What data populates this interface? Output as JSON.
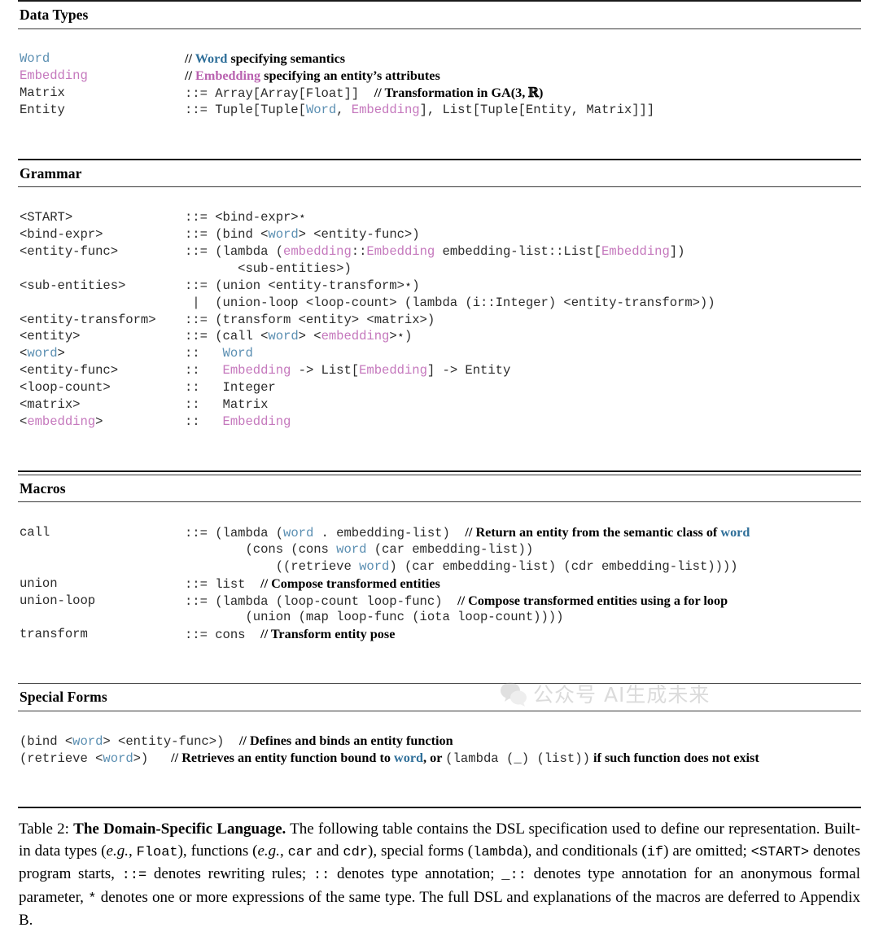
{
  "table": {
    "sections": [
      {
        "heading": "Data Types",
        "rows": [
          {
            "lhs": "Word",
            "lhs_color": "blue",
            "rhs": "// Word specifying semantics",
            "rhs_kind": "comment"
          },
          {
            "lhs": "Embedding",
            "lhs_color": "pink",
            "rhs": "// Embedding specifying an entity's attributes",
            "rhs_kind": "comment"
          },
          {
            "lhs": "Matrix",
            "lhs_color": "plain",
            "rhs": "::= Array[Array[Float]]  // Transformation in GA(3, R)"
          },
          {
            "lhs": "Entity",
            "lhs_color": "plain",
            "rhs": "::= Tuple[Tuple[Word, Embedding], List[Tuple[Entity, Matrix]]]"
          }
        ]
      },
      {
        "heading": "Grammar",
        "rows": [
          {
            "lhs": "<START>",
            "rhs": "::= <bind-expr>*"
          },
          {
            "lhs": "<bind-expr>",
            "rhs": "::= (bind <word> <entity-func>)"
          },
          {
            "lhs": "<entity-func>",
            "rhs": "::= (lambda (embedding::Embedding embedding-list::List[Embedding])"
          },
          {
            "lhs": "",
            "rhs": "       <sub-entities>)"
          },
          {
            "lhs": "<sub-entities>",
            "rhs": "::= (union <entity-transform>*)"
          },
          {
            "lhs": "",
            "rhs": " |  (union-loop <loop-count> (lambda (i::Integer) <entity-transform>))"
          },
          {
            "lhs": "<entity-transform>",
            "rhs": "::= (transform <entity> <matrix>)"
          },
          {
            "lhs": "<entity>",
            "rhs": "::= (call <word> <embedding>*)"
          },
          {
            "lhs": "<word>",
            "rhs": "::   Word"
          },
          {
            "lhs": "<entity-func>",
            "rhs": "::   Embedding -> List[Embedding] -> Entity"
          },
          {
            "lhs": "<loop-count>",
            "rhs": "::   Integer"
          },
          {
            "lhs": "<matrix>",
            "rhs": "::   Matrix"
          },
          {
            "lhs": "<embedding>",
            "rhs": "::   Embedding"
          }
        ]
      },
      {
        "heading": "Macros",
        "rows": [
          {
            "lhs": "call",
            "rhs": "::= (lambda (word . embedding-list)  // Return an entity from the semantic class of word"
          },
          {
            "lhs": "",
            "rhs": "        (cons (cons word (car embedding-list))"
          },
          {
            "lhs": "",
            "rhs": "            ((retrieve word) (car embedding-list) (cdr embedding-list))))"
          },
          {
            "lhs": "union",
            "rhs": "::= list  // Compose transformed entities"
          },
          {
            "lhs": "union-loop",
            "rhs": "::= (lambda (loop-count loop-func)  // Compose transformed entities using a for loop"
          },
          {
            "lhs": "",
            "rhs": "        (union (map loop-func (iota loop-count))))"
          },
          {
            "lhs": "transform",
            "rhs": "::= cons  // Transform entity pose"
          }
        ]
      },
      {
        "heading": "Special Forms",
        "rows": [
          {
            "rhs": "(bind <word> <entity-func>)  // Defines and binds an entity function"
          },
          {
            "rhs": "(retrieve <word>)   // Retrieves an entity function bound to word, or (lambda (_) (list)) if such function does not exist"
          }
        ]
      }
    ]
  },
  "caption": {
    "label": "Table 2:",
    "title": "The Domain-Specific Language.",
    "body_1": " The following table contains the DSL specification used to define our representation. Built-in data types (",
    "eg_1": "e.g.",
    "body_2": ", ",
    "mono_1": "Float",
    "body_3": "), functions (",
    "eg_2": "e.g.",
    "body_4": ", ",
    "mono_2": "car",
    "body_5": " and ",
    "mono_3": "cdr",
    "body_6": "), special forms (",
    "mono_4": "lambda",
    "body_7": "), and conditionals (",
    "mono_5": "if",
    "body_8": ") are omitted; ",
    "mono_6": "<START>",
    "body_9": " denotes program starts, ",
    "mono_7": "::=",
    "body_10": " denotes rewriting rules; ",
    "mono_8": "::",
    "body_11": " denotes type annotation; ",
    "mono_9": "_::",
    "body_12": " denotes type annotation for an anonymous formal parameter, ",
    "mono_10": "*",
    "body_13": " denotes one or more expressions of the same type. The full DSL and explanations of the macros are deferred to Appendix B."
  },
  "watermark": {
    "text": "公众号 AI生成未来",
    "logo": "wechat-logo"
  },
  "colors": {
    "word_blue": "#5b8fb2",
    "embedding_pink": "#c578bd",
    "code_gray": "#2b2b2b",
    "rule_dark": "#1a1a1a"
  }
}
